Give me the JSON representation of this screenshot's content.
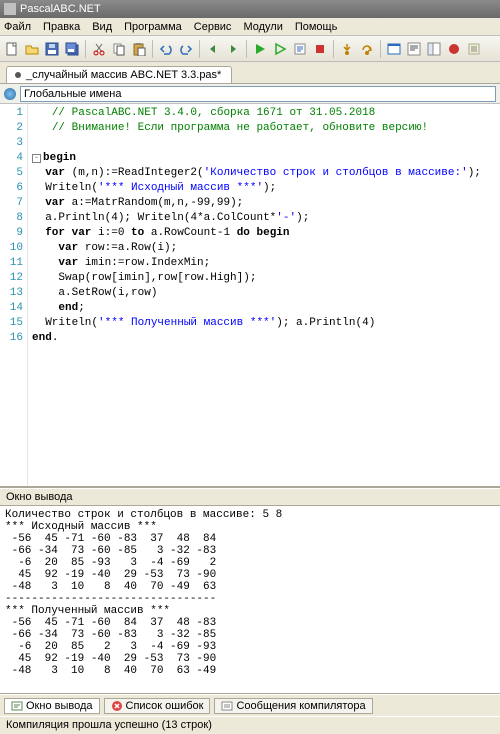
{
  "window": {
    "title": "PascalABC.NET"
  },
  "menu": {
    "file": "Файл",
    "edit": "Правка",
    "view": "Вид",
    "program": "Программа",
    "service": "Сервис",
    "modules": "Модули",
    "help": "Помощь"
  },
  "tab": {
    "label": "_случайный массив ABC.NET 3.3.pas*"
  },
  "scope": {
    "label": "Глобальные имена"
  },
  "code": {
    "lines": [
      "   // PascalABC.NET 3.4.0, сборка 1671 от 31.05.2018",
      "   // Внимание! Если программа не работает, обновите версию!",
      "",
      "begin",
      "  var (m,n):=ReadInteger2('Количество строк и столбцов в массиве:');",
      "  Writeln('*** Исходный массив ***');",
      "  var a:=MatrRandom(m,n,-99,99);",
      "  a.Println(4); Writeln(4*a.ColCount*'-');",
      "  for var i:=0 to a.RowCount-1 do begin",
      "    var row:=a.Row(i);",
      "    var imin:=row.IndexMin;",
      "    Swap(row[imin],row[row.High]);",
      "    a.SetRow(i,row)",
      "    end;",
      "  Writeln('*** Полученный массив ***'); a.Println(4)",
      "end."
    ],
    "l1a": "   ",
    "l1b": "// PascalABC.NET 3.4.0, сборка 1671 от 31.05.2018",
    "l2a": "   ",
    "l2b": "// Внимание! Если программа не работает, обновите версию!",
    "l4a": "begin",
    "l5a": "  ",
    "l5b": "var",
    "l5c": " (m,n):=ReadInteger2(",
    "l5d": "'Количество строк и столбцов в массиве:'",
    "l5e": ");",
    "l6a": "  Writeln(",
    "l6b": "'*** Исходный массив ***'",
    "l6c": ");",
    "l7a": "  ",
    "l7b": "var",
    "l7c": " a:=MatrRandom(m,n,-",
    "l7d": "99",
    "l7e": ",",
    "l7f": "99",
    "l7g": ");",
    "l8a": "  a.Println(",
    "l8b": "4",
    "l8c": "); Writeln(",
    "l8d": "4",
    "l8e": "*a.ColCount*",
    "l8f": "'-'",
    "l8g": ");",
    "l9a": "  ",
    "l9b": "for var",
    "l9c": " i:=",
    "l9d": "0",
    "l9e": " ",
    "l9f": "to",
    "l9g": " a.RowCount-",
    "l9h": "1",
    "l9i": " ",
    "l9j": "do begin",
    "l10a": "    ",
    "l10b": "var",
    "l10c": " row:=a.Row(i);",
    "l11a": "    ",
    "l11b": "var",
    "l11c": " imin:=row.IndexMin;",
    "l12a": "    Swap(row[imin],row[row.High]);",
    "l13a": "    a.SetRow(i,row)",
    "l14a": "    ",
    "l14b": "end",
    "l14c": ";",
    "l15a": "  Writeln(",
    "l15b": "'*** Полученный массив ***'",
    "l15c": "); a.Println(",
    "l15d": "4",
    "l15e": ")",
    "l16a": "end",
    "l16b": "."
  },
  "gutter": [
    "1",
    "2",
    "3",
    "4",
    "5",
    "6",
    "7",
    "8",
    "9",
    "10",
    "11",
    "12",
    "13",
    "14",
    "15",
    "16"
  ],
  "output": {
    "title": "Окно вывода",
    "text": "Количество строк и столбцов в массиве: 5 8\n*** Исходный массив ***\n -56  45 -71 -60 -83  37  48  84\n -66 -34  73 -60 -85   3 -32 -83\n  -6  20  85 -93   3  -4 -69   2\n  45  92 -19 -40  29 -53  73 -90\n -48   3  10   8  40  70 -49  63\n--------------------------------\n*** Полученный массив ***\n -56  45 -71 -60  84  37  48 -83\n -66 -34  73 -60 -83   3 -32 -85\n  -6  20  85   2   3  -4 -69 -93\n  45  92 -19 -40  29 -53  73 -90\n -48   3  10   8  40  70  63 -49"
  },
  "bottomTabs": {
    "out": "Окно вывода",
    "errors": "Список ошибок",
    "compiler": "Сообщения компилятора"
  },
  "status": {
    "text": "Компиляция прошла успешно (13 строк)"
  },
  "icons": {
    "new": "new-file-icon",
    "open": "open-icon",
    "save": "save-icon",
    "saveall": "save-all-icon",
    "cut": "cut-icon",
    "copy": "copy-icon",
    "paste": "paste-icon",
    "undo": "undo-icon",
    "redo": "redo-icon",
    "nav1": "nav-back-icon",
    "nav2": "nav-fwd-icon",
    "run": "run-icon",
    "runcur": "run-current-icon",
    "pause": "debug-icon",
    "stop": "stop-icon",
    "stepin": "step-into-icon",
    "stepover": "step-over-icon",
    "form": "form-designer-icon",
    "props": "properties-icon",
    "events": "events-icon",
    "align": "align-icon"
  }
}
